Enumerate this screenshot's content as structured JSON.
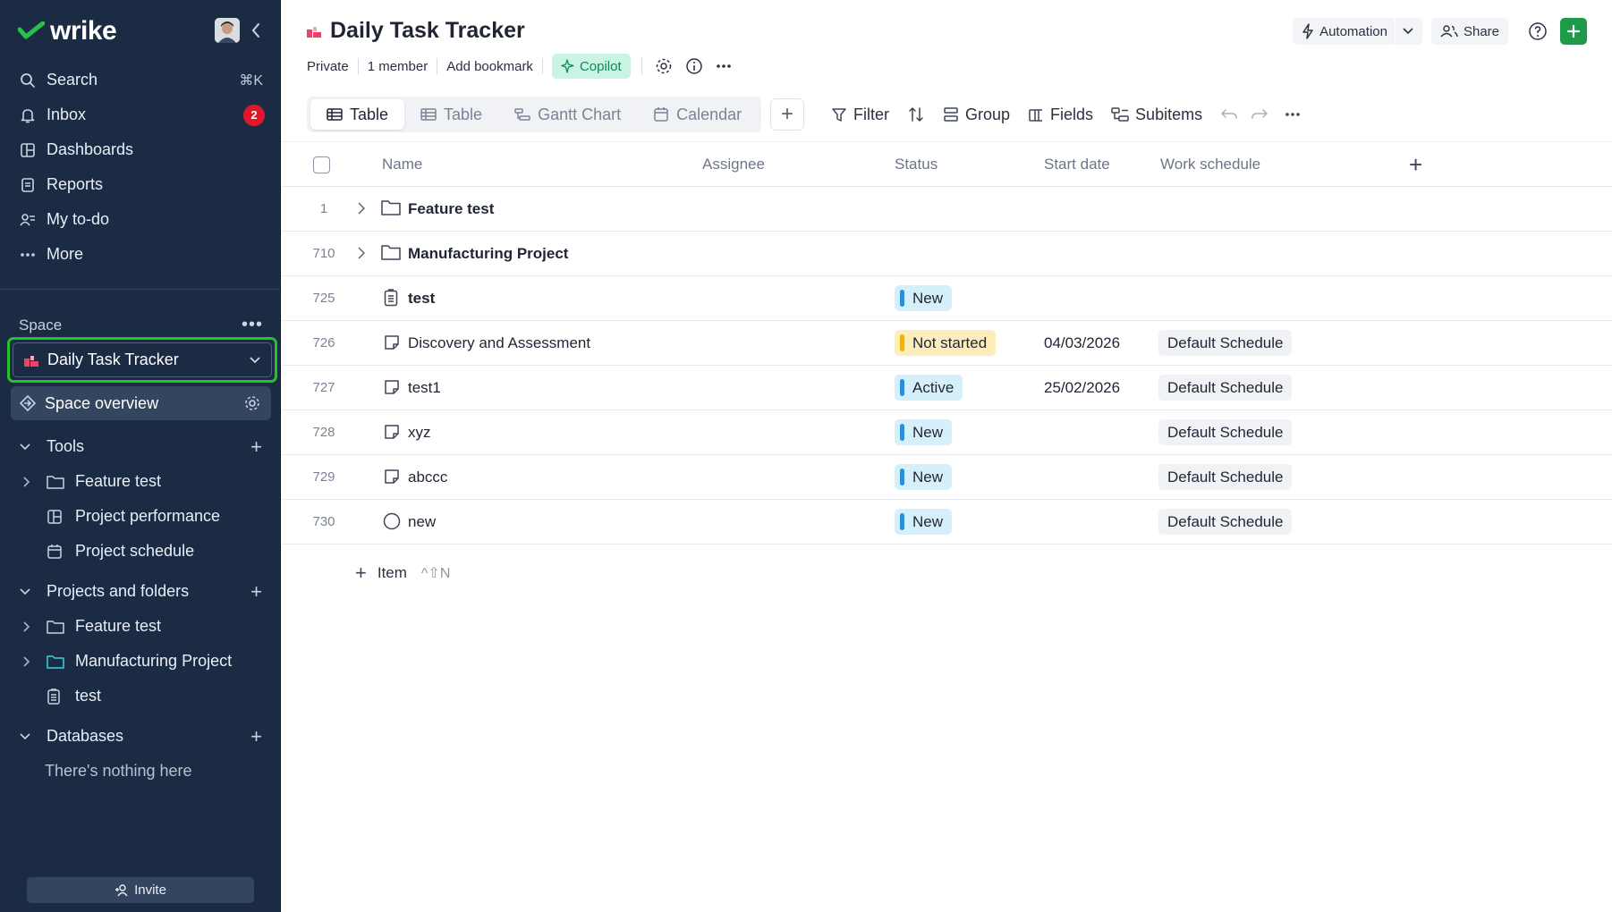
{
  "app": {
    "logo_text": "wrike"
  },
  "sidebar": {
    "nav": [
      {
        "label": "Search",
        "icon": "search-icon",
        "shortcut": "⌘K"
      },
      {
        "label": "Inbox",
        "icon": "bell-icon",
        "badge": "2"
      },
      {
        "label": "Dashboards",
        "icon": "dashboard-icon"
      },
      {
        "label": "Reports",
        "icon": "reports-icon"
      },
      {
        "label": "My to-do",
        "icon": "todo-icon"
      },
      {
        "label": "More",
        "icon": "more-dots-icon"
      }
    ],
    "space_label": "Space",
    "space_name": "Daily Task Tracker",
    "space_overview": "Space overview",
    "sections": {
      "tools": {
        "label": "Tools",
        "items": [
          {
            "label": "Feature test",
            "icon": "folder-icon"
          },
          {
            "label": "Project performance",
            "icon": "dashboard-icon"
          },
          {
            "label": "Project schedule",
            "icon": "calendar-icon"
          }
        ]
      },
      "projects": {
        "label": "Projects and folders",
        "items": [
          {
            "label": "Feature test",
            "icon": "folder-icon"
          },
          {
            "label": "Manufacturing Project",
            "icon": "project-folder-icon"
          },
          {
            "label": "test",
            "icon": "task-list-icon"
          }
        ]
      },
      "databases": {
        "label": "Databases",
        "empty": "There's nothing here"
      }
    },
    "invite_label": "Invite"
  },
  "header": {
    "title": "Daily Task Tracker",
    "automation": "Automation",
    "share": "Share",
    "meta": {
      "privacy": "Private",
      "members": "1 member",
      "bookmark": "Add bookmark",
      "copilot": "Copilot"
    }
  },
  "views": {
    "tabs": [
      {
        "label": "Table",
        "active": true
      },
      {
        "label": "Table",
        "active": false
      },
      {
        "label": "Gantt Chart",
        "active": false
      },
      {
        "label": "Calendar",
        "active": false
      }
    ]
  },
  "toolbar": {
    "filter": "Filter",
    "group": "Group",
    "fields": "Fields",
    "subitems": "Subitems"
  },
  "table": {
    "columns": {
      "name": "Name",
      "assignee": "Assignee",
      "status": "Status",
      "start": "Start date",
      "schedule": "Work schedule"
    },
    "rows": [
      {
        "id": "1",
        "name": "Feature test",
        "type": "folder",
        "status": "",
        "start": "",
        "schedule": ""
      },
      {
        "id": "710",
        "name": "Manufacturing Project",
        "type": "folder",
        "status": "",
        "start": "",
        "schedule": ""
      },
      {
        "id": "725",
        "name": "test",
        "type": "list",
        "status": "New",
        "start": "",
        "schedule": ""
      },
      {
        "id": "726",
        "name": "Discovery and Assessment",
        "type": "task",
        "status": "Not started",
        "start": "04/03/2026",
        "schedule": "Default Schedule"
      },
      {
        "id": "727",
        "name": "test1",
        "type": "task",
        "status": "Active",
        "start": "25/02/2026",
        "schedule": "Default Schedule"
      },
      {
        "id": "728",
        "name": "xyz",
        "type": "task",
        "status": "New",
        "start": "",
        "schedule": "Default Schedule"
      },
      {
        "id": "729",
        "name": "abccc",
        "type": "task",
        "status": "New",
        "start": "",
        "schedule": "Default Schedule"
      },
      {
        "id": "730",
        "name": "new",
        "type": "milestone",
        "status": "New",
        "start": "",
        "schedule": "Default Schedule"
      }
    ],
    "add_item": "Item",
    "add_item_shortcut": "^⇧N"
  },
  "colors": {
    "sidebar_bg": "#1b2b44",
    "accent_green": "#1e9b48",
    "highlight": "#22c12e",
    "status_new": "#2a8fd8",
    "status_not_started": "#f0b10a"
  }
}
